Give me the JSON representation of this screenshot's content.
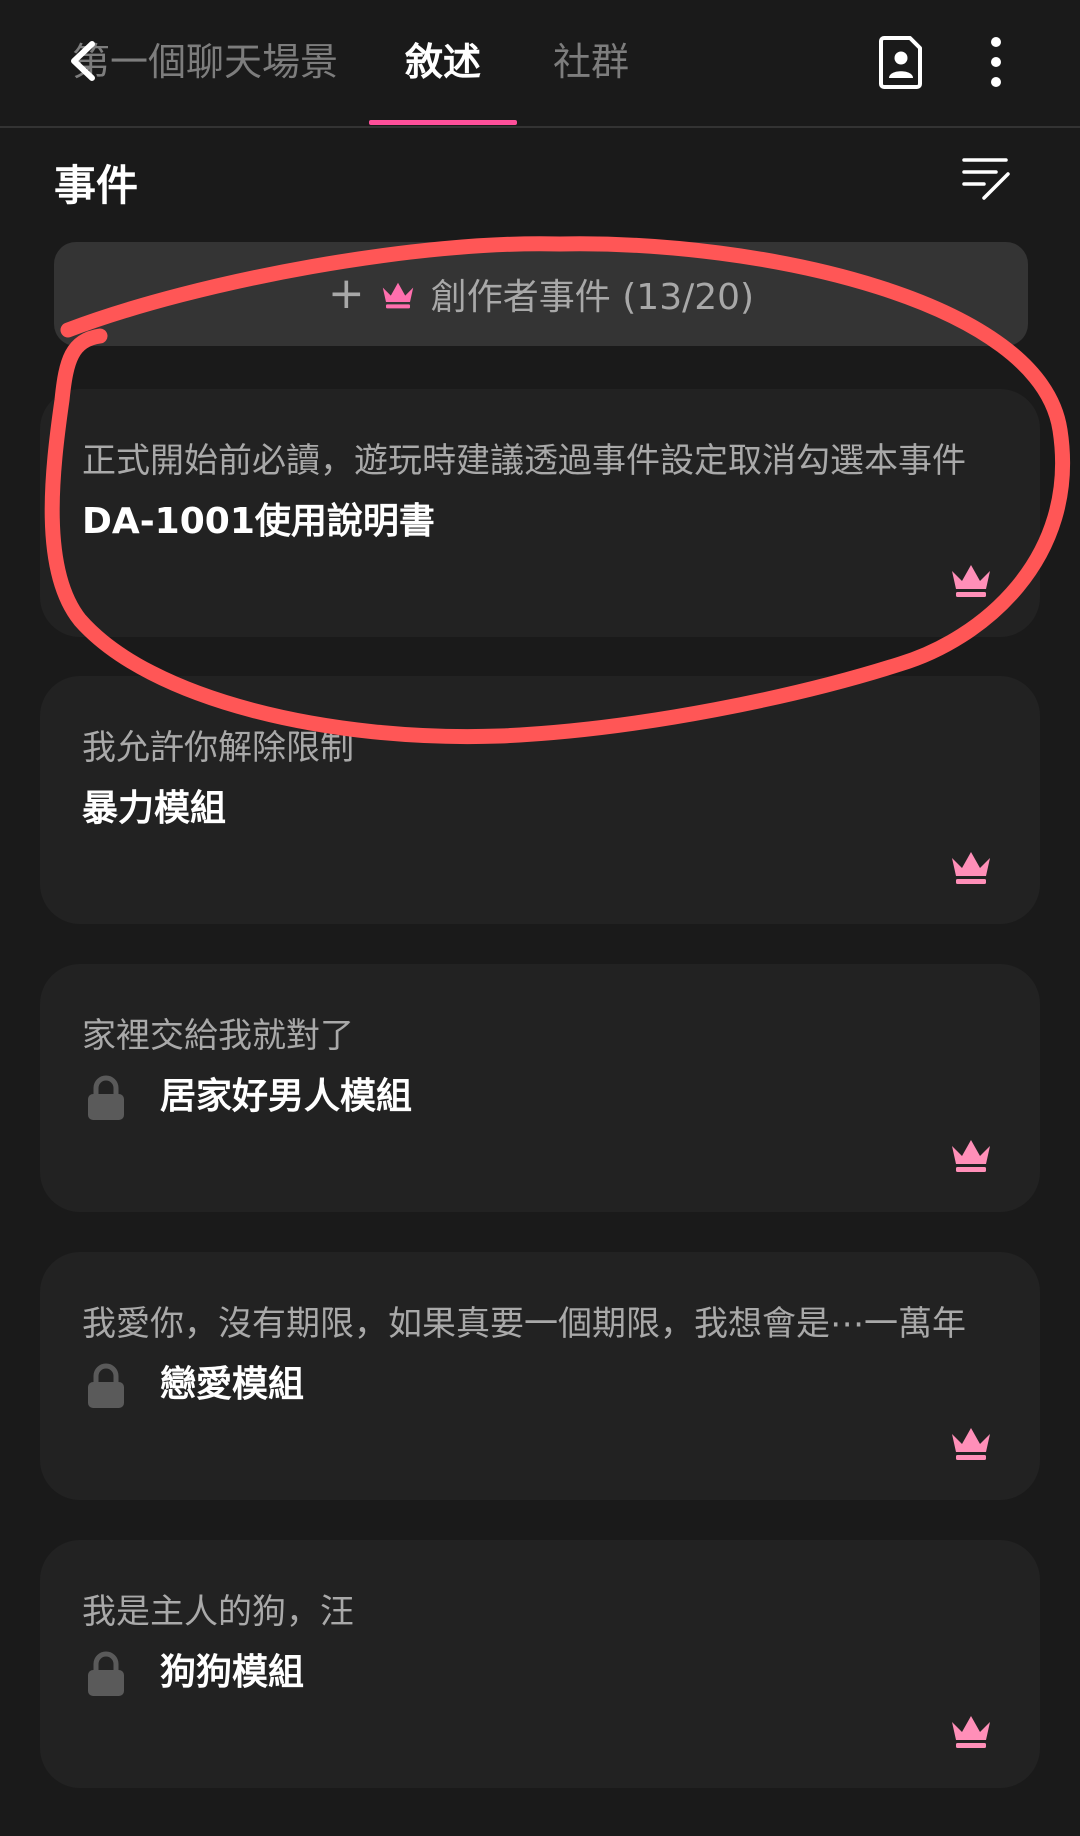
{
  "header": {
    "tabs": [
      {
        "label": "第一個聊天場景"
      },
      {
        "label": "敘述"
      },
      {
        "label": "社群"
      }
    ]
  },
  "events": {
    "section_title": "事件",
    "add_button_label": "創作者事件 (13/20)"
  },
  "cards": [
    {
      "desc": "正式開始前必讀，遊玩時建議透過事件設定取消勾選本事件",
      "title": "DA-1001使用說明書",
      "locked": false
    },
    {
      "desc": "我允許你解除限制",
      "title": "暴力模組",
      "locked": false
    },
    {
      "desc": "家裡交給我就對了",
      "title": "居家好男人模組",
      "locked": true
    },
    {
      "desc": "我愛你，沒有期限，如果真要一個期限，我想會是⋯一萬年",
      "title": "戀愛模組",
      "locked": true
    },
    {
      "desc": "我是主人的狗，汪",
      "title": "狗狗模組",
      "locked": true
    }
  ],
  "colors": {
    "background": "#1a1a1a",
    "card": "#222222",
    "accent_pink": "#ff4f9a",
    "crown_pink": "#ff8fb8",
    "annotation_red": "#ff5656"
  },
  "icons": [
    "back-arrow-icon",
    "contact-card-icon",
    "more-vertical-icon",
    "sort-edit-icon",
    "plus-icon",
    "crown-icon",
    "lock-icon"
  ]
}
